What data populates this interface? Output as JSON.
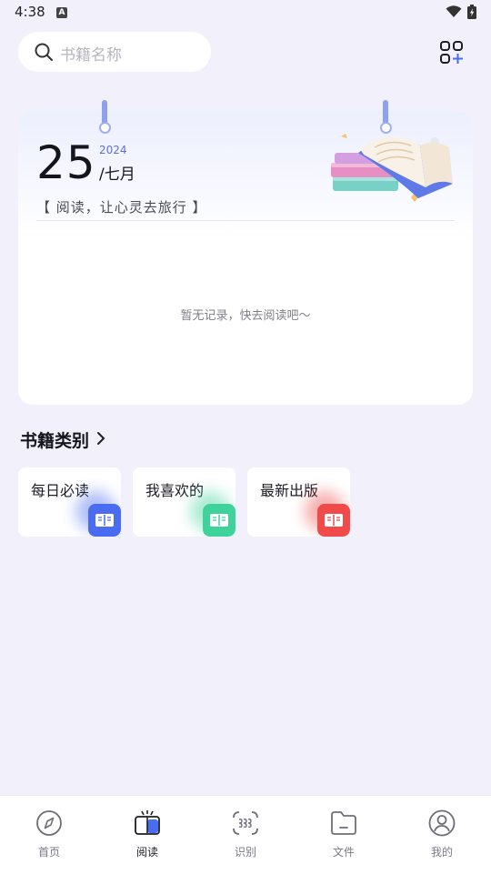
{
  "status_bar": {
    "time": "4:38",
    "notification_icon": "a-icon",
    "wifi_icon": "wifi-icon",
    "battery_icon": "battery-charging-icon"
  },
  "search": {
    "placeholder": "书籍名称",
    "icon": "search-icon"
  },
  "scan_button": {
    "icon": "grid-plus-icon"
  },
  "calendar": {
    "day": "25",
    "year": "2024",
    "month": "/七月",
    "slogan": "【 阅读，让心灵去旅行 】",
    "empty_message": "暂无记录，快去阅读吧～"
  },
  "categories": {
    "title": "书籍类别",
    "items": [
      {
        "label": "每日必读",
        "color": "#4a6cf1"
      },
      {
        "label": "我喜欢的",
        "color": "#3fd39c"
      },
      {
        "label": "最新出版",
        "color": "#f04a4a"
      }
    ]
  },
  "nav": {
    "items": [
      {
        "label": "首页",
        "icon": "compass-icon"
      },
      {
        "label": "阅读",
        "icon": "book-tv-icon",
        "active": true
      },
      {
        "label": "识别",
        "icon": "scan-text-icon"
      },
      {
        "label": "文件",
        "icon": "folder-icon"
      },
      {
        "label": "我的",
        "icon": "user-icon"
      }
    ]
  },
  "colors": {
    "accent": "#4a6cf1",
    "background": "#f2f1fb"
  }
}
